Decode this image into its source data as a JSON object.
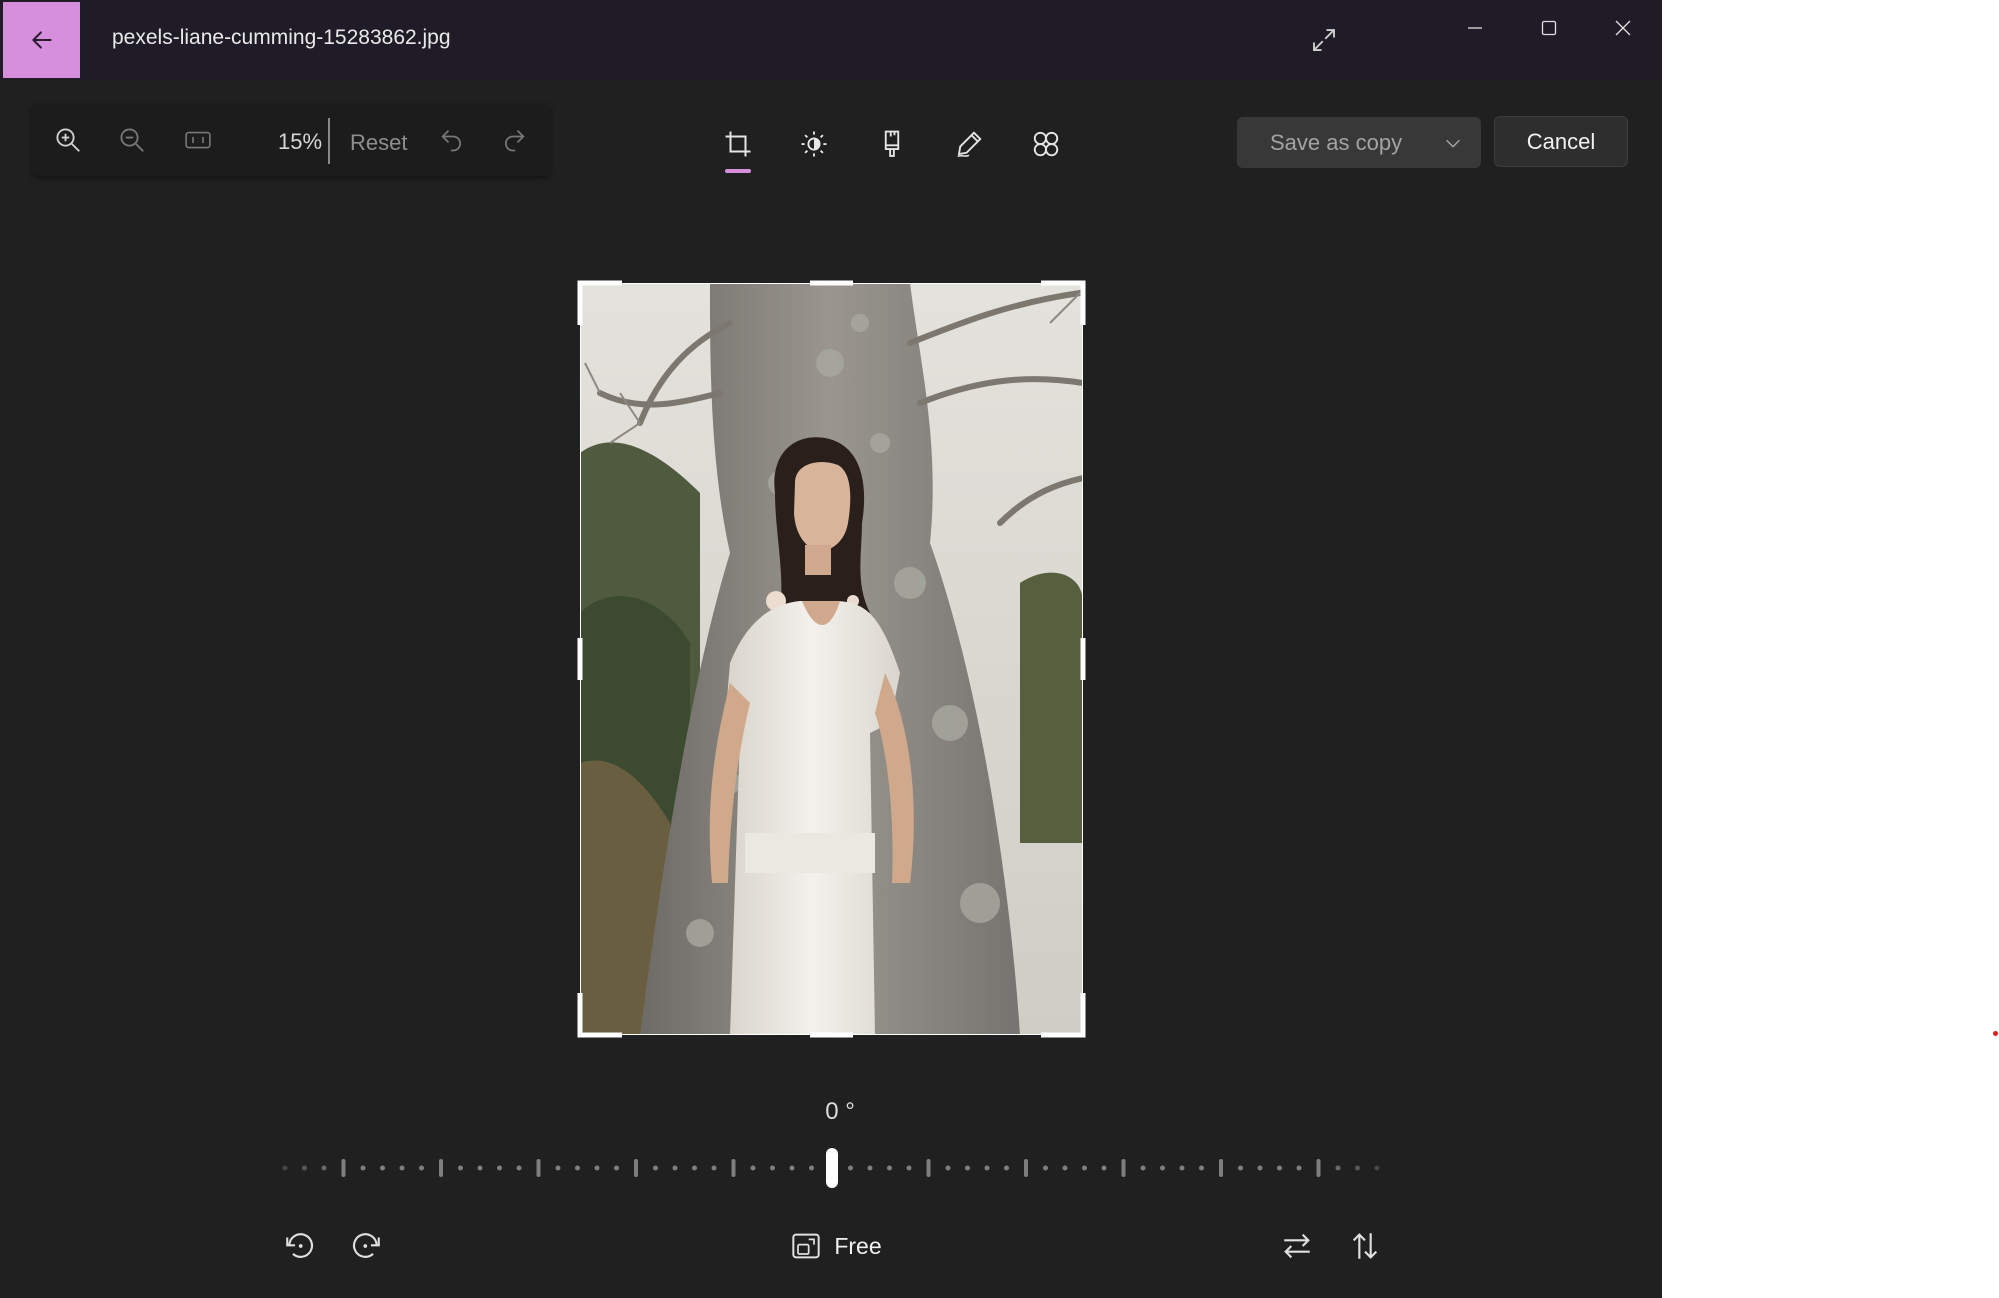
{
  "window": {
    "filename": "pexels-liane-cumming-15283862.jpg",
    "accent_color": "#d58fdc"
  },
  "toolbar": {
    "zoom_level": "15%",
    "reset_label": "Reset",
    "icons": [
      "zoom-in-icon",
      "zoom-out-icon",
      "actual-size-icon",
      "undo-icon",
      "redo-icon"
    ]
  },
  "tools": {
    "tabs": [
      "crop",
      "adjustment",
      "filter",
      "markup",
      "background-effects"
    ],
    "active": "crop"
  },
  "actions": {
    "save_copy_label": "Save as copy",
    "cancel_label": "Cancel"
  },
  "crop": {
    "rotation_label": "0 °",
    "rotation_degrees": 0,
    "aspect_label": "Free"
  }
}
